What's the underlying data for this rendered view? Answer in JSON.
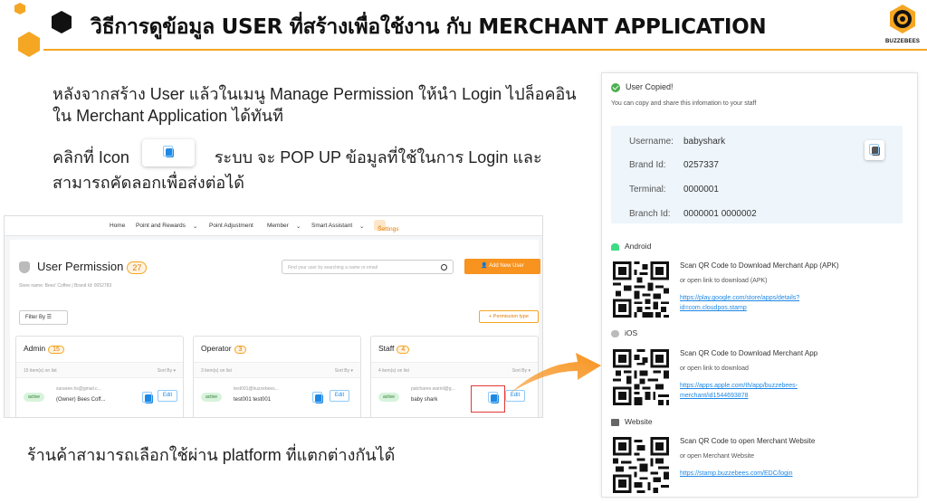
{
  "header": {
    "title": "วิธีการดูข้อมูล USER ที่สร้างเพื่อใช้งาน กับ MERCHANT APPLICATION",
    "logo_text": "BUZZEBEES",
    "accent": "#f5a623"
  },
  "body": {
    "line1": "หลังจากสร้าง User แล้วในเมนู Manage Permission ให้นำ Login ไปล็อคอิน",
    "line2": "ใน Merchant Application ได้ทันที",
    "click_prefix": "คลิกที่ Icon",
    "click_suffix": "ระบบ จะ POP UP  ข้อมูลที่ใช้ในการ Login  และ",
    "line4": "สามารถคัดลอกเพื่อส่งต่อได้",
    "footer": "ร้านค้าสามารถเลือกใช้ผ่าน platform ที่แตกต่างกันได้"
  },
  "screenshot": {
    "nav": {
      "home": "Home",
      "points": "Point and Rewards",
      "adjust": "Point Adjustment",
      "member": "Member",
      "assistant": "Smart Assistant",
      "settings": "Settings"
    },
    "title": "User Permission",
    "count": "27",
    "store": "Store name: Bees' Coffee | Brand Id: 0052783",
    "search_placeholder": "Find your user by searching a name or email",
    "add_button": "Add New User",
    "filter": "Filter By",
    "permission_type": "Permission type",
    "columns": [
      {
        "title": "Admin",
        "count": "15",
        "items": "15 item(s) on list",
        "sort": "Sort By",
        "status": "active",
        "email": "sunaree.hs@gmail.c...",
        "name": "(Owner) Bees Coff...",
        "edit": "Edit"
      },
      {
        "title": "Operator",
        "count": "3",
        "items": "3 item(s) on list",
        "sort": "Sort By",
        "status": "active",
        "email": "test001@buzzebees...",
        "name": "test001 test001",
        "edit": "Edit"
      },
      {
        "title": "Staff",
        "count": "4",
        "items": "4 item(s) on list",
        "sort": "Sort By",
        "status": "active",
        "email": "patcharee.warnil@g...",
        "name": "baby shark",
        "edit": "Edit"
      }
    ]
  },
  "popup": {
    "copied": "User Copied!",
    "sub": "You can copy and share this infomation to your staff",
    "username_label": "Username:",
    "username": "babyshark",
    "brand_label": "Brand Id:",
    "brand": "0257337",
    "terminal_label": "Terminal:",
    "terminal": "0000001",
    "branch_label": "Branch Id:",
    "branch": "0000001  0000002",
    "android": {
      "label": "Android",
      "title": "Scan QR Code to Download Merchant App (APK)",
      "or": "or open link to download (APK)",
      "link": "https://play.google.com/store/apps/details?id=com.cloudpos.stamp"
    },
    "ios": {
      "label": "iOS",
      "title": "Scan QR Code to Download Merchant App",
      "or": "or open link to download",
      "link": "https://apps.apple.com/th/app/buzzebees-merchant/id1544693878"
    },
    "web": {
      "label": "Website",
      "title": "Scan QR Code to open Merchant Website",
      "or": "or open Merchant Website",
      "link": "https://stamp.buzzebees.com/EDC/login"
    }
  }
}
